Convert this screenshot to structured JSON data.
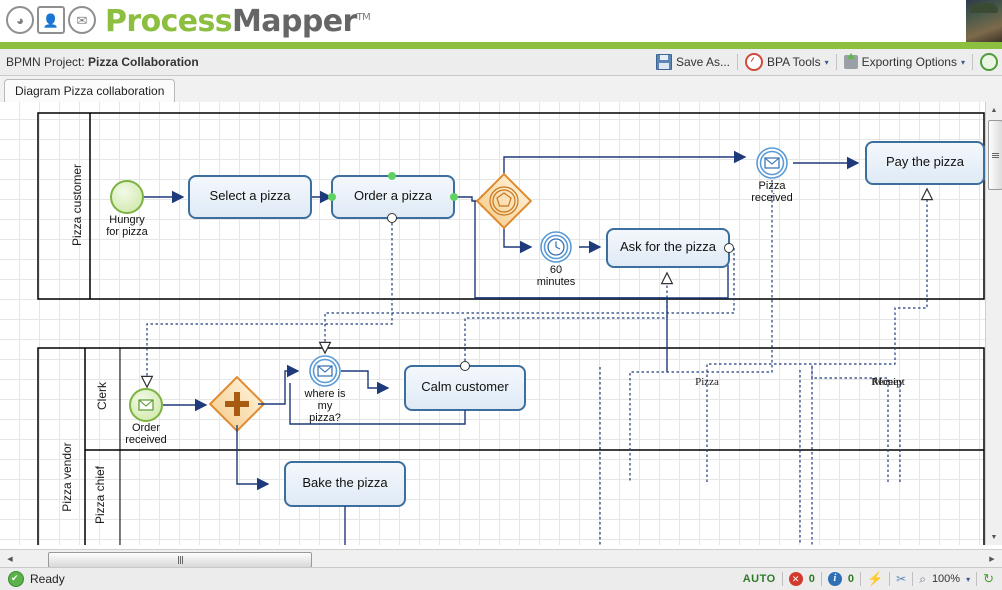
{
  "app": {
    "logo_text_a": "Process",
    "logo_text_b": "Mapper",
    "logo_tm": "TM",
    "logo_icons": [
      "gauge-icon",
      "user-icon",
      "envelope-icon"
    ],
    "avatar_name": "user-avatar"
  },
  "projectbar": {
    "prefix": "BPMN Project: ",
    "project_name": "Pizza Collaboration",
    "tools": [
      {
        "name": "save-as-button",
        "label": "Save As...",
        "icon": "floppy-disk-icon",
        "caret": false
      },
      {
        "name": "bpa-tools-menu",
        "label": "BPA Tools",
        "icon": "gauge-icon",
        "caret": true
      },
      {
        "name": "exporting-options-menu",
        "label": "Exporting Options",
        "icon": "export-icon",
        "caret": true
      }
    ],
    "caret_glyph": "▾"
  },
  "tabs": [
    {
      "name": "tab-diagram-pizza-collaboration",
      "label": "Diagram Pizza collaboration",
      "active": true
    }
  ],
  "diagram": {
    "pools": [
      {
        "name": "pool-pizza-customer",
        "label": "Pizza customer",
        "lanes": []
      },
      {
        "name": "pool-pizza-vendor",
        "label": "Pizza vendor",
        "lanes": [
          {
            "name": "lane-clerk",
            "label": "Clerk"
          },
          {
            "name": "lane-pizza-chief",
            "label": "Pizza chief"
          }
        ]
      }
    ],
    "events": [
      {
        "name": "start-event-hungry-for-pizza",
        "label": "Hungry\nfor pizza",
        "type": "start-none"
      },
      {
        "name": "timer-event-60-minutes",
        "label": "60\nminutes",
        "type": "intermediate-timer"
      },
      {
        "name": "message-event-pizza-received",
        "label": "Pizza\nreceived",
        "type": "intermediate-message"
      },
      {
        "name": "start-event-order-received",
        "label": "Order\nreceived",
        "type": "start-message"
      },
      {
        "name": "message-event-where-is-my-pizza",
        "label": "where is\nmy\npizza?",
        "type": "intermediate-message"
      }
    ],
    "tasks": [
      {
        "name": "task-select-a-pizza",
        "label": "Select a pizza"
      },
      {
        "name": "task-order-a-pizza",
        "label": "Order a pizza"
      },
      {
        "name": "task-ask-for-the-pizza",
        "label": "Ask for the pizza"
      },
      {
        "name": "task-pay-the-pizza",
        "label": "Pay the pizza"
      },
      {
        "name": "task-calm-customer",
        "label": "Calm customer"
      },
      {
        "name": "task-bake-the-pizza",
        "label": "Bake the pizza"
      }
    ],
    "gateways": [
      {
        "name": "gateway-event-based",
        "type": "event-based"
      },
      {
        "name": "gateway-parallel",
        "type": "parallel"
      }
    ],
    "flow_labels": [
      {
        "name": "message-flow-label-pizza",
        "label": "Pizza"
      },
      {
        "name": "message-flow-label-money",
        "label": "Money"
      },
      {
        "name": "message-flow-label-receipt",
        "label": "Receipt"
      }
    ],
    "colors": {
      "task_fill": "#eaf1f9",
      "task_stroke": "#3c6e9e",
      "flow_stroke": "#1f3a7a",
      "gateway_fill": "#fbe2c0",
      "gateway_stroke": "#e08a2e",
      "start_stroke": "#7cb342",
      "message_stroke": "#5b9bd5",
      "selection_dot": "#5fd35f",
      "grid": "#e6e6e6"
    }
  },
  "scrollbars": {
    "v_up_glyph": "▲",
    "v_down_glyph": "▼",
    "h_left_glyph": "◀",
    "h_right_glyph": "▶"
  },
  "statusbar": {
    "status_text": "Ready",
    "auto_label": "AUTO",
    "error_count": "0",
    "info_count": "0",
    "error_glyph": "✕",
    "info_glyph": "i",
    "bolt_glyph": "⚡",
    "wrench_glyph": "ὒ7",
    "zoom_glyph": "⌕",
    "zoom_level": "100%",
    "zoom_caret": "▾",
    "refresh_glyph": "↻"
  }
}
